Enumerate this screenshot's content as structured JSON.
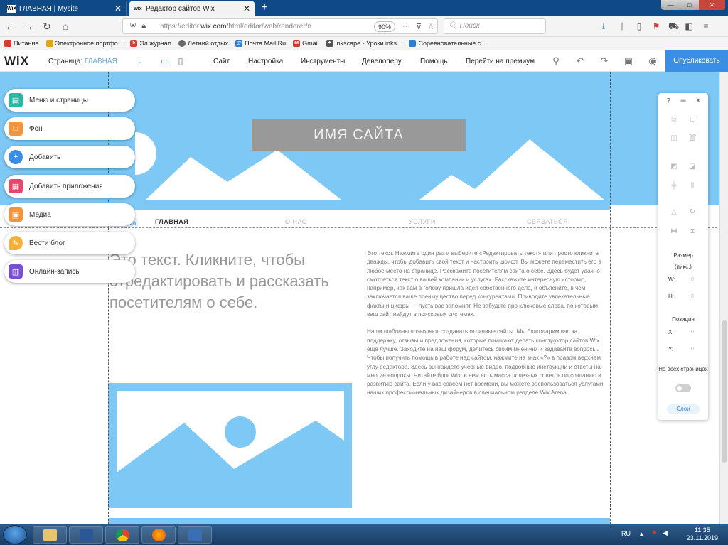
{
  "browser": {
    "tabs": [
      {
        "icon": "wix-icon",
        "favicon_text": "WiX",
        "label": "ГЛАВНАЯ | Mysite",
        "active": false
      },
      {
        "icon": "wix-icon",
        "favicon_text": "wix",
        "label": "Редактор сайтов Wix",
        "active": true
      }
    ],
    "new_tab": "+",
    "window_controls": [
      "—",
      "□",
      "✕"
    ],
    "url_prefix": "https://editor.",
    "url_domain": "wix.com",
    "url_rest": "/html/editor/web/renderer/n",
    "zoom": "90%",
    "url_more": "···",
    "search_placeholder": "Поиск",
    "bookmarks": [
      {
        "icon": "bookmark-icon",
        "label": "Питание",
        "color": "#d93c2f"
      },
      {
        "icon": "folder-icon",
        "label": "Электронное портфо...",
        "color": "#e2a61b"
      },
      {
        "icon": "s-icon",
        "label": "Эл.журнал",
        "color": "#d93c2f"
      },
      {
        "icon": "globe-icon",
        "label": "Летний отдых",
        "color": "#6a6a6a"
      },
      {
        "icon": "mail-icon",
        "label": "Почта Mail.Ru",
        "color": "#2b7fd8"
      },
      {
        "icon": "gmail-icon",
        "label": "Gmail",
        "color": "#d93c2f"
      },
      {
        "icon": "inkscape-icon",
        "label": "inkscape - Уроки inks...",
        "color": "#555555"
      },
      {
        "icon": "grid-icon",
        "label": "Соревновательные с...",
        "color": "#2b7fd8"
      }
    ]
  },
  "wix": {
    "logo": "WiX",
    "page_label": "Страница:",
    "page_current": "ГЛАВНАЯ",
    "menu": [
      "Сайт",
      "Настройка",
      "Инструменты",
      "Девелоперу",
      "Помощь",
      "Перейти на премиум"
    ],
    "publish": "Опубликовать"
  },
  "left_panel": [
    {
      "label": "Меню и страницы",
      "icon": "pages-icon",
      "color": "#26b8a5",
      "glyph": "▤"
    },
    {
      "label": "Фон",
      "icon": "background-icon",
      "color": "#f3933b",
      "glyph": "□"
    },
    {
      "label": "Добавить",
      "icon": "add-icon",
      "color": "#3a8ee6",
      "glyph": "+"
    },
    {
      "label": "Добавить приложения",
      "icon": "apps-icon",
      "color": "#e8466e",
      "glyph": "▦"
    },
    {
      "label": "Медиа",
      "icon": "media-icon",
      "color": "#f3933b",
      "glyph": "▣"
    },
    {
      "label": "Вести блог",
      "icon": "blog-icon",
      "color": "#f3b13b",
      "glyph": "✎"
    },
    {
      "label": "Онлайн-запись",
      "icon": "booking-icon",
      "color": "#7a4fd1",
      "glyph": "▥"
    }
  ],
  "site": {
    "name": "ИМЯ САЙТА",
    "page_tag": "Страница",
    "nav": [
      "ГЛАВНАЯ",
      "О НАС",
      "УСЛУГИ",
      "СВЯЗАТЬСЯ"
    ],
    "heading": "Это текст. Кликните, чтобы отредактировать и рассказать посетителям о себе.",
    "paragraphs": [
      "Это текст. Нажмите один раз и выберите «Редактировать текст» или просто кликните дважды, чтобы добавить свой текст и настроить шрифт. Вы можете переместить его в любое место на странице. Расскажите посетителям сайта о себе. Здесь будет удачно смотреться текст о вашей компании и услугах. Расскажите интересную историю, например, как вам в голову пришла идея собственного дела, и объясните, в чем заключается ваше преимущество перед конкурентами. Приводите увлекательные факты и цифры — пусть вас запомнят. Не забудьте про ключевые слова, по которым ваш сайт найдут в поисковых системах.",
      "Наши шаблоны позволяют создавать отличные сайты. Мы благодарим вас за поддержку, отзывы и предложения, которые помогают делать конструктор сайтов Wix еще лучше. Заходите на наш форум, делитесь своим мнением и задавайте вопросы. Чтобы получить помощь в работе над сайтом, нажмите на знак «?» в правом верхнем углу редактора. Здесь вы найдете учебные видео, подробные инструкции и ответы на многие вопросы. Читайте блог Wix: в нем есть масса полезных советов по созданию и развитию сайта. Если у вас совсем нет времени, вы можете воспользоваться услугами наших профессиональных дизайнеров в специальном разделе Wix Arena."
    ]
  },
  "right_panel": {
    "top": [
      "?",
      "═",
      "✕"
    ],
    "size_label": "Размер",
    "size_unit": "(пикс.)",
    "w_label": "W:",
    "h_label": "H:",
    "pos_label": "Позиция",
    "x_label": "X:",
    "y_label": "Y:",
    "field_value": "0",
    "all_pages": "На всех страницах",
    "help": "Слои"
  },
  "taskbar": {
    "lang": "RU",
    "time": "11:35",
    "date": "23.11.2019"
  }
}
